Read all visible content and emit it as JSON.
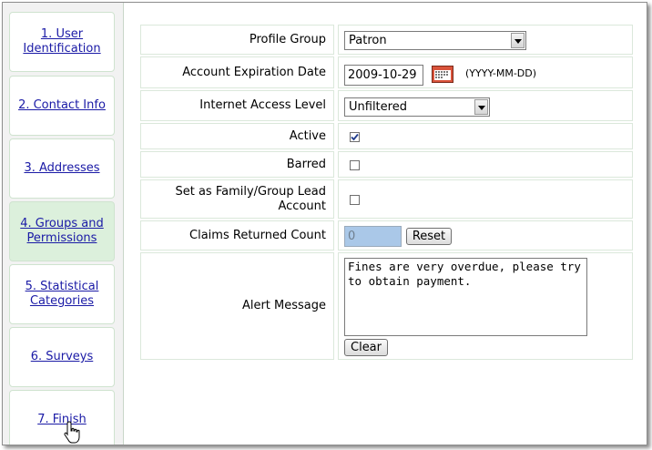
{
  "sidebar": {
    "items": [
      {
        "label": "1. User Identification"
      },
      {
        "label": "2. Contact Info"
      },
      {
        "label": "3. Addresses"
      },
      {
        "label": "4. Groups and Permissions"
      },
      {
        "label": "5. Statistical Categories"
      },
      {
        "label": "6. Surveys"
      },
      {
        "label": "7. Finish"
      }
    ],
    "active_index": 3
  },
  "form": {
    "profile_group": {
      "label": "Profile Group",
      "value": "Patron"
    },
    "account_expiration": {
      "label": "Account Expiration Date",
      "value": "2009-10-29",
      "hint": "(YYYY-MM-DD)"
    },
    "internet_access": {
      "label": "Internet Access Level",
      "value": "Unfiltered"
    },
    "active": {
      "label": "Active",
      "checked": true
    },
    "barred": {
      "label": "Barred",
      "checked": false
    },
    "family_lead": {
      "label": "Set as Family/Group Lead Account",
      "checked": false
    },
    "claims_returned": {
      "label": "Claims Returned Count",
      "value": "0",
      "button": "Reset"
    },
    "alert_message": {
      "label": "Alert Message",
      "value": "Fines are very overdue, please try to obtain payment.",
      "button": "Clear"
    }
  }
}
